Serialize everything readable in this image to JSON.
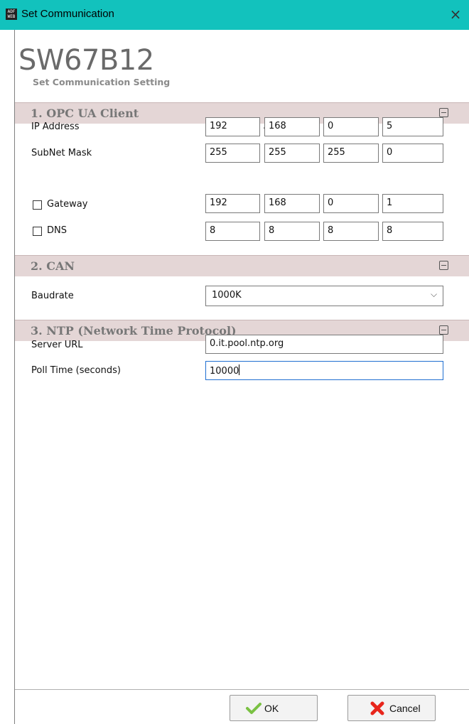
{
  "window": {
    "title": "Set Communication",
    "app_icon_text": "ADF WEB",
    "close_glyph": "×"
  },
  "header": {
    "model": "SW67B12",
    "subtitle": "Set Communication Setting"
  },
  "sections": {
    "opcua": {
      "title": "1. OPC UA Client",
      "ip_label": "IP Address",
      "ip": [
        "192",
        "168",
        "0",
        "5"
      ],
      "mask_label": "SubNet Mask",
      "mask": [
        "255",
        "255",
        "255",
        "0"
      ],
      "gateway_label": "Gateway",
      "gateway_checked": false,
      "gateway": [
        "192",
        "168",
        "0",
        "1"
      ],
      "dns_label": "DNS",
      "dns_checked": false,
      "dns": [
        "8",
        "8",
        "8",
        "8"
      ]
    },
    "can": {
      "title": "2. CAN",
      "baudrate_label": "Baudrate",
      "baudrate": "1000K"
    },
    "ntp": {
      "title": "3. NTP (Network Time Protocol)",
      "server_label": "Server URL",
      "server": "0.it.pool.ntp.org",
      "poll_label": "Poll Time (seconds)",
      "poll": "10000"
    }
  },
  "buttons": {
    "ok": "OK",
    "cancel": "Cancel"
  },
  "colors": {
    "titlebar": "#12c2bd",
    "section_bg": "#e4d6d6",
    "ok_icon": "#7ac143",
    "cancel_icon": "#e8261c"
  }
}
